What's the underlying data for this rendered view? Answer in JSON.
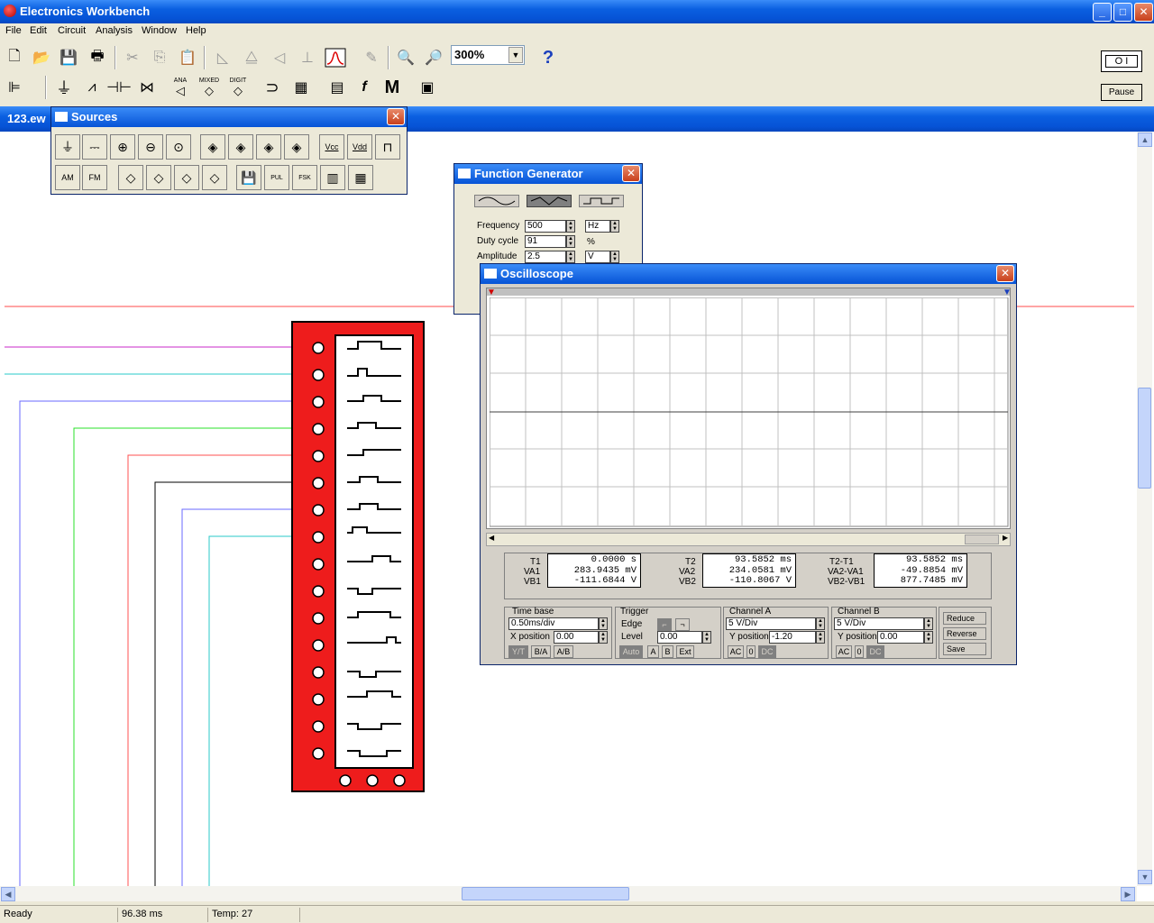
{
  "app": {
    "title": "Electronics Workbench"
  },
  "menu": [
    "File",
    "Edit",
    "Circuit",
    "Analysis",
    "Window",
    "Help"
  ],
  "toolbar": {
    "zoom": "300%",
    "pause": "Pause",
    "power_label": "O I"
  },
  "components_toolbar": {
    "ana": "ANA",
    "mixed": "MIXED",
    "digit": "DIGIT",
    "m": "M"
  },
  "document": {
    "title": "123.ew"
  },
  "sources": {
    "title": "Sources",
    "vcc": "Vcc",
    "vdd": "Vdd",
    "am": "AM",
    "fm": "FM",
    "pul": "PUL",
    "fsk": "FSK"
  },
  "function_generator": {
    "title": "Function Generator",
    "frequency_label": "Frequency",
    "frequency_value": "500",
    "frequency_unit": "Hz",
    "duty_label": "Duty cycle",
    "duty_value": "91",
    "duty_unit": "%",
    "amplitude_label": "Amplitude",
    "amplitude_value": "2.5",
    "amplitude_unit": "V"
  },
  "oscilloscope": {
    "title": "Oscilloscope",
    "t1": {
      "label": "T1",
      "value": "0.0000 s"
    },
    "va1": {
      "label": "VA1",
      "value": "283.9435 mV"
    },
    "vb1": {
      "label": "VB1",
      "value": "-111.6844 V"
    },
    "t2": {
      "label": "T2",
      "value": "93.5852 ms"
    },
    "va2": {
      "label": "VA2",
      "value": "234.0581 mV"
    },
    "vb2": {
      "label": "VB2",
      "value": "-110.8067 V"
    },
    "dt": {
      "label": "T2-T1",
      "value": "93.5852 ms"
    },
    "dva": {
      "label": "VA2-VA1",
      "value": "-49.8854 mV"
    },
    "dvb": {
      "label": "VB2-VB1",
      "value": "877.7485 mV"
    },
    "timebase": {
      "label": "Time base",
      "value": "0.50ms/div",
      "xpos_label": "X position",
      "xpos": "0.00",
      "yt": "Y/T",
      "ba": "B/A",
      "ab": "A/B"
    },
    "trigger": {
      "label": "Trigger",
      "edge_label": "Edge",
      "level_label": "Level",
      "level": "0.00",
      "auto": "Auto",
      "a": "A",
      "b": "B",
      "ext": "Ext"
    },
    "channel_a": {
      "label": "Channel A",
      "scale": "5 V/Div",
      "ypos_label": "Y position",
      "ypos": "-1.20",
      "ac": "AC",
      "zero": "0",
      "dc": "DC"
    },
    "channel_b": {
      "label": "Channel B",
      "scale": "5 V/Div",
      "ypos_label": "Y position",
      "ypos": "0.00",
      "ac": "AC",
      "zero": "0",
      "dc": "DC"
    },
    "buttons": {
      "reduce": "Reduce",
      "reverse": "Reverse",
      "save": "Save"
    }
  },
  "status": {
    "state": "Ready",
    "time": "96.38 ms",
    "temp": "Temp:  27"
  },
  "colors": {
    "accent": "#0653d6",
    "generator_red": "#ee1c1c"
  }
}
